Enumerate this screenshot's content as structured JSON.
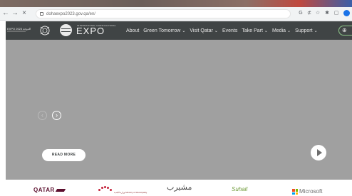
{
  "browser": {
    "back_glyph": "←",
    "forward_glyph": "→",
    "close_glyph": "×",
    "url": "dohaexpo2023.gov.qa/en/",
    "tools": [
      "G",
      "⊄",
      "☆",
      "✱",
      "▢"
    ]
  },
  "header": {
    "small_logo_text": "EXPO 2023 الدوحة",
    "expo_small": "INTERNATIONAL HORTICULTURAL",
    "expo_big": "EXPO",
    "nav": [
      {
        "label": "About",
        "dropdown": false
      },
      {
        "label": "Green Tomorrow",
        "dropdown": true
      },
      {
        "label": "Visit Qatar",
        "dropdown": true
      },
      {
        "label": "Events",
        "dropdown": false
      },
      {
        "label": "Take Part",
        "dropdown": true
      },
      {
        "label": "Media",
        "dropdown": true
      },
      {
        "label": "Support",
        "dropdown": true
      }
    ],
    "caret": "⌄",
    "lang_icon": "⊕"
  },
  "hero": {
    "prev_glyph": "‹",
    "next_glyph": "›",
    "read_more": "READ MORE"
  },
  "sponsors": {
    "qatar": "QATAR",
    "ministry_text": "وزارة البلدية Ministry of Municipality",
    "arabic": "مشيرب",
    "sustain": "Suhail",
    "microsoft": "Microsoft"
  },
  "colors": {
    "header_bg": "#404445",
    "hero_bg": "#a0a0a0",
    "accent_green": "#8fc98a",
    "qatar_maroon": "#5c0f2e"
  }
}
